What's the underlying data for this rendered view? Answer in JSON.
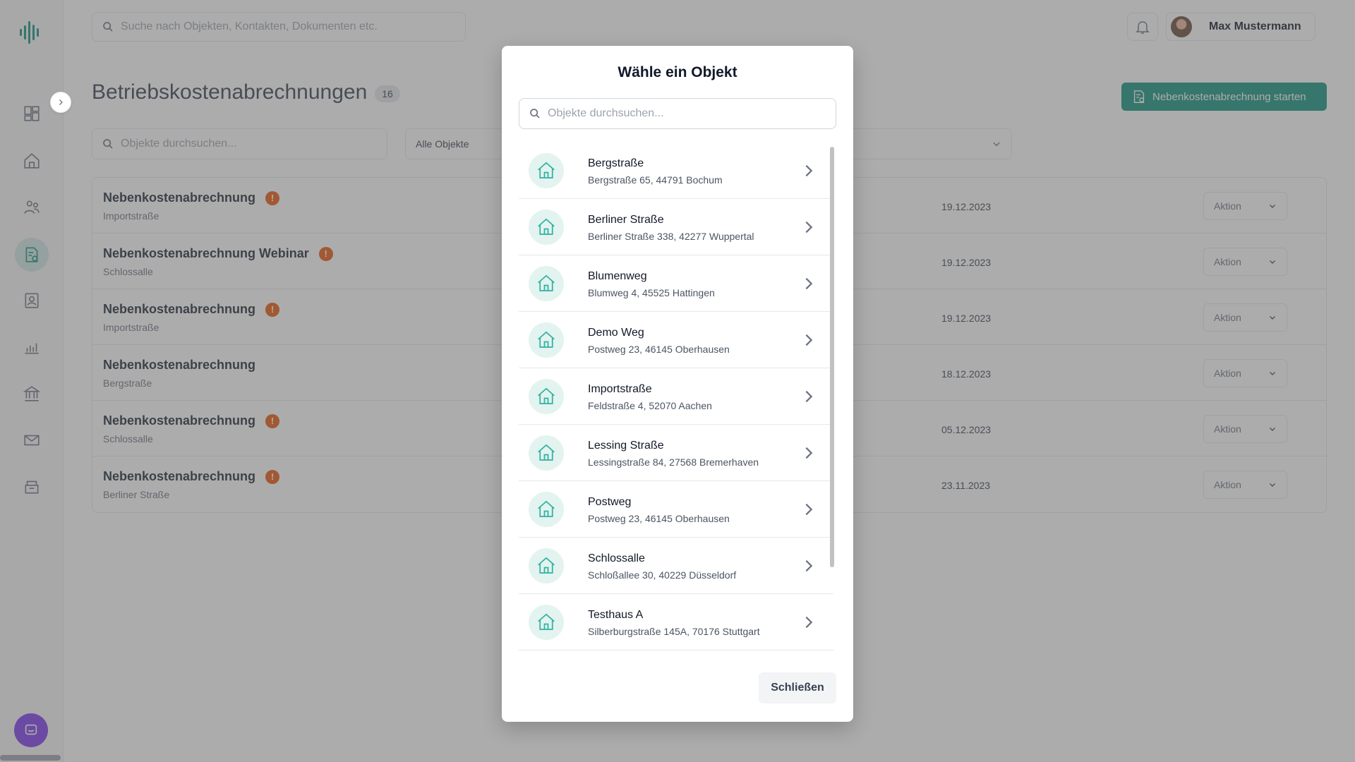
{
  "header": {
    "search_placeholder": "Suche nach Objekten, Kontakten, Dokumenten etc.",
    "user_name": "Max Mustermann"
  },
  "page": {
    "title": "Betriebskostenabrechnungen",
    "count": "16",
    "start_button": "Nebenkostenabrechnung starten",
    "search_placeholder": "Objekte durchsuchen...",
    "filter_label": "Alle Objekte"
  },
  "rows": [
    {
      "title": "Nebenkostenabrechnung",
      "sub": "Importstraße",
      "date": "19.12.2023",
      "action": "Aktion",
      "warn": "!"
    },
    {
      "title": "Nebenkostenabrechnung Webinar",
      "sub": "Schlossalle",
      "date": "19.12.2023",
      "action": "Aktion",
      "warn": "!"
    },
    {
      "title": "Nebenkostenabrechnung",
      "sub": "Importstraße",
      "date": "19.12.2023",
      "action": "Aktion",
      "warn": "!"
    },
    {
      "title": "Nebenkostenabrechnung",
      "sub": "Bergstraße",
      "date": "18.12.2023",
      "action": "Aktion",
      "warn": ""
    },
    {
      "title": "Nebenkostenabrechnung",
      "sub": "Schlossalle",
      "date": "05.12.2023",
      "action": "Aktion",
      "warn": "!"
    },
    {
      "title": "Nebenkostenabrechnung",
      "sub": "Berliner Straße",
      "date": "23.11.2023",
      "action": "Aktion",
      "warn": "!"
    }
  ],
  "modal": {
    "title": "Wähle ein Objekt",
    "search_placeholder": "Objekte durchsuchen...",
    "close_button": "Schließen",
    "items": [
      {
        "name": "Bergstraße",
        "address": "Bergstraße 65, 44791 Bochum"
      },
      {
        "name": "Berliner Straße",
        "address": "Berliner Straße 338, 42277 Wuppertal"
      },
      {
        "name": "Blumenweg",
        "address": "Blumweg 4, 45525 Hattingen"
      },
      {
        "name": "Demo Weg",
        "address": "Postweg 23, 46145 Oberhausen"
      },
      {
        "name": "Importstraße",
        "address": "Feldstraße 4, 52070 Aachen"
      },
      {
        "name": "Lessing Straße",
        "address": "Lessingstraße 84, 27568 Bremerhaven"
      },
      {
        "name": "Postweg",
        "address": "Postweg 23, 46145 Oberhausen"
      },
      {
        "name": "Schlossalle",
        "address": "Schloßallee 30, 40229 Düsseldorf"
      },
      {
        "name": "Testhaus A",
        "address": "Silberburgstraße 145A, 70176 Stuttgart"
      }
    ]
  },
  "colors": {
    "brand": "#15937f",
    "warning": "#e8590c",
    "house_icon": "#2fb3a0"
  },
  "icons": {
    "logo": "soundwave-logo-icon",
    "nav": [
      "dashboard-icon",
      "home-icon",
      "users-icon",
      "billing-document-icon",
      "contact-card-icon",
      "bar-chart-icon",
      "bank-icon",
      "mail-icon",
      "archive-box-icon"
    ]
  }
}
